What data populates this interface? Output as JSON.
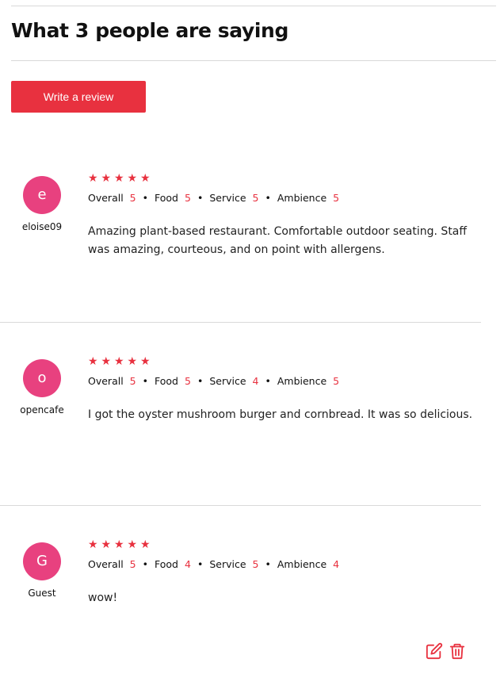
{
  "header": {
    "title": "What 3 people are saying",
    "write_review_label": "Write a review"
  },
  "rating_labels": {
    "overall": "Overall",
    "food": "Food",
    "service": "Service",
    "ambience": "Ambience",
    "separator": "•"
  },
  "reviews": [
    {
      "initial": "e",
      "username": "eloise09",
      "stars": "★★★★★",
      "ratings": {
        "overall": "5",
        "food": "5",
        "service": "5",
        "ambience": "5"
      },
      "text": "Amazing plant-based restaurant. Comfortable outdoor seating. Staff was amazing, courteous, and on point with allergens."
    },
    {
      "initial": "o",
      "username": "opencafe",
      "stars": "★★★★★",
      "ratings": {
        "overall": "5",
        "food": "5",
        "service": "4",
        "ambience": "5"
      },
      "text": "I got the oyster mushroom burger and cornbread. It was so delicious."
    },
    {
      "initial": "G",
      "username": "Guest",
      "stars": "★★★★★",
      "ratings": {
        "overall": "5",
        "food": "4",
        "service": "5",
        "ambience": "4"
      },
      "text": "wow!"
    }
  ],
  "actions": {
    "edit_icon": "edit-icon",
    "delete_icon": "trash-icon"
  },
  "colors": {
    "accent": "#e8313f",
    "avatar": "#e8417f",
    "divider": "#d9d9d9"
  }
}
